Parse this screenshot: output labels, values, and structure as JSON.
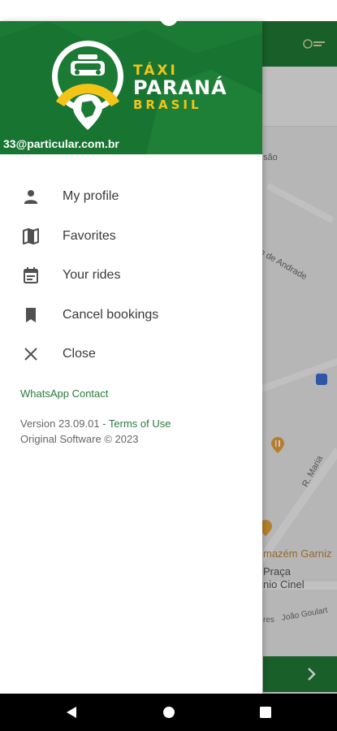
{
  "drawer": {
    "brand": {
      "taxi": "TÁXI",
      "parana": "PARANÁ",
      "brasil": "BRASIL"
    },
    "user_email": "33@particular.com.br",
    "menu": [
      {
        "label": "My profile",
        "icon": "person-icon"
      },
      {
        "label": "Favorites",
        "icon": "map-icon"
      },
      {
        "label": "Your rides",
        "icon": "calendar-icon"
      },
      {
        "label": "Cancel bookings",
        "icon": "bookmark-icon"
      },
      {
        "label": "Close",
        "icon": "close-icon"
      }
    ],
    "whatsapp_label": "WhatsApp Contact",
    "version_prefix": "Version 23.09.01 - ",
    "terms_label": "Terms of Use",
    "copyright": "Original Software © 2023"
  },
  "background_map": {
    "labels": [
      "são",
      "no de Andrade",
      "R. Maria",
      "mazém Garniz",
      "Praça",
      "nio Cinel",
      "res",
      "João Goulart"
    ]
  },
  "colors": {
    "brand_green": "#1b7a34",
    "brand_yellow": "#f3c418",
    "link_green": "#2a7a3d"
  }
}
